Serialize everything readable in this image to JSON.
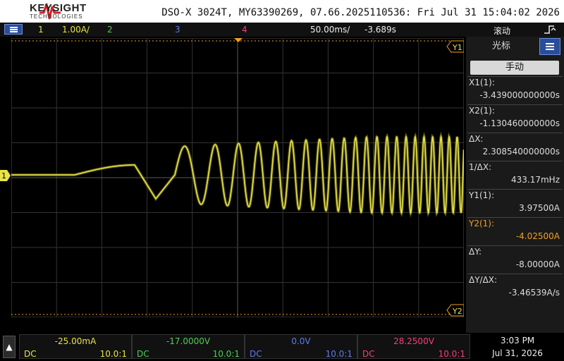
{
  "header": {
    "brand": "KEYSIGHT",
    "brand_sub": "TECHNOLOGIES",
    "device_info": "DSO-X 3024T, MY63390269, 07.66.2025110536: Fri Jul 31 15:04:02 2026"
  },
  "channel_bar": {
    "ch1_label": "1",
    "ch1_scale": "1.00A/",
    "ch2_label": "2",
    "ch3_label": "3",
    "ch4_label": "4",
    "time_scale": "50.00ms/",
    "time_delay": "-3.689s",
    "mode": "滚动",
    "menu_icon": "menu-icon",
    "trigger_icon": "trigger-icon"
  },
  "markers": {
    "y1": "Y1",
    "y2": "Y2",
    "ch1": "1"
  },
  "side_panel": {
    "title": "光标",
    "mode_button": "手动",
    "measurements": [
      {
        "label": "X1(1):",
        "value": "-3.439000000000s",
        "color": "#dddddd"
      },
      {
        "label": "X2(1):",
        "value": "-1.130460000000s",
        "color": "#dddddd"
      },
      {
        "label": "ΔX:",
        "value": "2.308540000000s",
        "color": "#dddddd"
      },
      {
        "label": "1/ΔX:",
        "value": "433.17mHz",
        "color": "#dddddd"
      },
      {
        "label": "Y1(1):",
        "value": "3.97500A",
        "color": "#dddddd"
      },
      {
        "label": "Y2(1):",
        "value": "-4.02500A",
        "color": "#f0a020"
      },
      {
        "label": "ΔY:",
        "value": "-8.00000A",
        "color": "#dddddd"
      },
      {
        "label": "ΔY/ΔX:",
        "value": "-3.46539A/s",
        "color": "#dddddd"
      }
    ]
  },
  "bottom_bar": {
    "up_icon": "up-arrow-icon",
    "channels": [
      {
        "value": "-25.00mA",
        "coupling": "DC",
        "probe": "10.0:1",
        "color": "#e8e34a"
      },
      {
        "value": "-17.0000V",
        "coupling": "DC",
        "probe": "10.0:1",
        "color": "#4fcf4f"
      },
      {
        "value": "0.0V",
        "coupling": "DC",
        "probe": "10.0:1",
        "color": "#5a7cf2"
      },
      {
        "value": "28.2500V",
        "coupling": "DC",
        "probe": "10.0:1",
        "color": "#f2407a"
      }
    ],
    "time": "3:03 PM",
    "date": "Jul 31, 2026"
  },
  "colors": {
    "ch1": "#e8e34a",
    "ch2": "#4fcf4f",
    "ch3": "#5a7cf2",
    "ch4": "#f2407a",
    "cursor": "#f0a020",
    "accent": "#2a4d9b"
  }
}
